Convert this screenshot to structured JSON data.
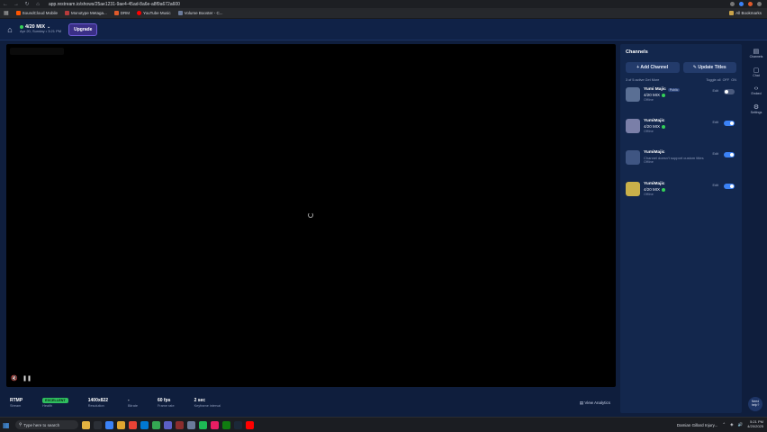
{
  "browser": {
    "url": "app.restream.io/shows/25ae1231-9ae4-45ad-8a6e-a8f9a672a600",
    "bookmarks": [
      {
        "label": "SoundCloud Mobile",
        "color": "#ff5500"
      },
      {
        "label": "Monotype Metaga...",
        "color": "#b83b3b"
      },
      {
        "label": "DRM",
        "color": "#e05a2b"
      },
      {
        "label": "YouTube Music",
        "color": "#ff0000"
      },
      {
        "label": "Volume Booster - C...",
        "color": "#6b7b9a"
      }
    ],
    "all_bookmarks": "All Bookmarks"
  },
  "header": {
    "title": "4/20 MIX",
    "subtitle": "Apr 20, Sunday • 3:21 PM",
    "upgrade_label": "Upgrade"
  },
  "player": {
    "mute_icon": "mute-icon",
    "pause_icon": "pause-icon"
  },
  "stats": [
    {
      "value": "RTMP",
      "label": "Stream"
    },
    {
      "value": "EXCELLENT",
      "label": "Health",
      "badge": true
    },
    {
      "value": "1400x822",
      "label": "Resolution"
    },
    {
      "value": "-",
      "label": "Bitrate"
    },
    {
      "value": "60 fps",
      "label": "Frame rate"
    },
    {
      "value": "2 sec",
      "label": "Keyframe interval"
    }
  ],
  "view_analytics": "View Analytics",
  "channels_panel": {
    "title": "Channels",
    "add_channel": "Add Channel",
    "update_titles": "Update Titles",
    "count_text": "3 of 5 active Get More",
    "toggle_all": "Toggle all",
    "off": "OFF",
    "on": "ON",
    "channels": [
      {
        "name": "Yumi Majic",
        "badge": "Public",
        "title": "4/20 MIX",
        "status": "Offline",
        "edit": "Edit",
        "on": false,
        "color": "#5a6f94"
      },
      {
        "name": "YumiMajic",
        "badge": "",
        "title": "4/20 MIX",
        "status": "Offline",
        "edit": "Edit",
        "on": true,
        "color": "#7a7fa8"
      },
      {
        "name": "YumiMajic",
        "badge": "",
        "title": "Channel doesn't support custom titles",
        "status": "Offline",
        "edit": "Edit",
        "on": true,
        "color": "#3f5582"
      },
      {
        "name": "YumiMajic",
        "badge": "",
        "title": "4/20 MIX",
        "status": "Offline",
        "edit": "Edit",
        "on": true,
        "color": "#c9b04a"
      }
    ]
  },
  "rail": [
    {
      "label": "Channels",
      "icon": "channels-icon",
      "glyph": "▤"
    },
    {
      "label": "Chat",
      "icon": "chat-icon",
      "glyph": "▢"
    },
    {
      "label": "Embed",
      "icon": "embed-icon",
      "glyph": "‹›"
    },
    {
      "label": "Settings",
      "icon": "settings-icon",
      "glyph": "⚙"
    }
  ],
  "help": {
    "line1": "Need",
    "line2": "help?"
  },
  "taskbar": {
    "search_placeholder": "Type here to search",
    "user": "Damian Gillard Injury...",
    "time": "5:21 PM",
    "date": "4/20/2025"
  }
}
